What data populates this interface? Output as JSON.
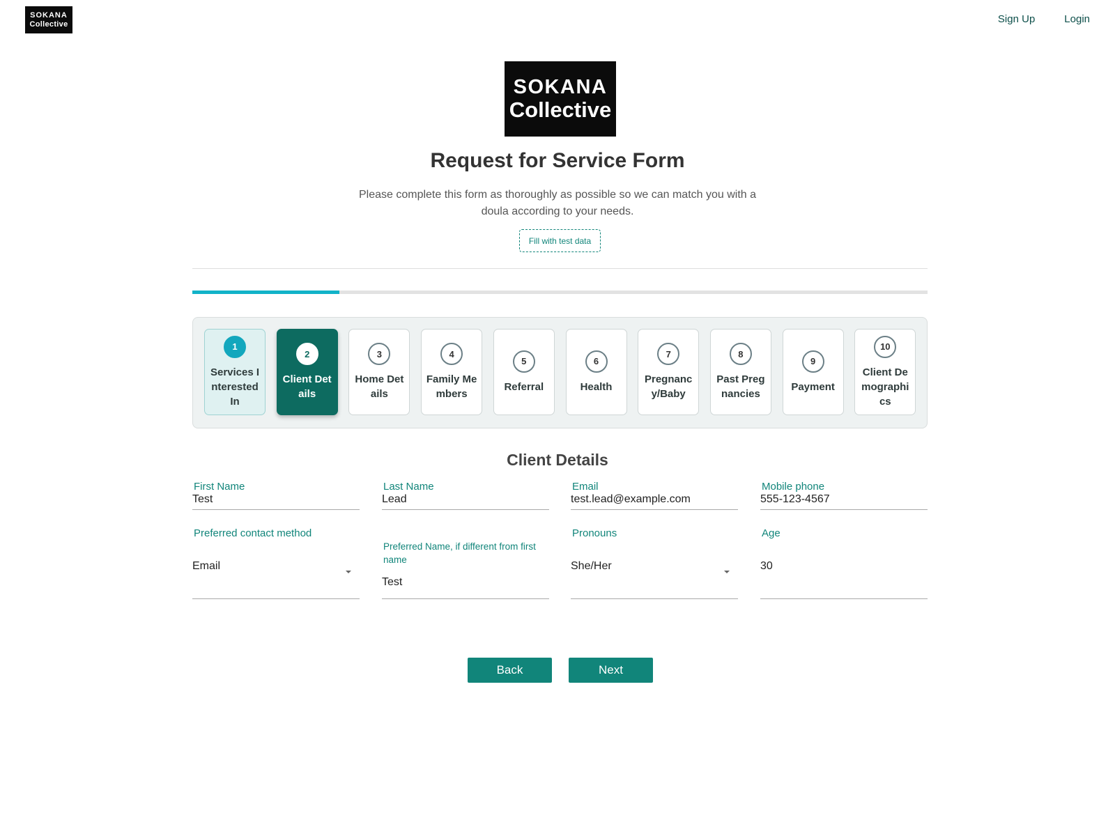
{
  "topbar": {
    "logo_line1": "SOKANA",
    "logo_line2": "Collective",
    "signup_label": "Sign Up",
    "login_label": "Login"
  },
  "header": {
    "logo_line1": "SOKANA",
    "logo_line2": "Collective",
    "title": "Request for Service Form",
    "subtitle": "Please complete this form as thoroughly as possible so we can match you with a doula according to your needs.",
    "test_data_label": "Fill with test data"
  },
  "progress": {
    "fraction": 0.2
  },
  "steps": [
    {
      "number": "1",
      "label": "Services Interested In",
      "state": "done"
    },
    {
      "number": "2",
      "label": "Client Details",
      "state": "active"
    },
    {
      "number": "3",
      "label": "Home Details",
      "state": "todo"
    },
    {
      "number": "4",
      "label": "Family Members",
      "state": "todo"
    },
    {
      "number": "5",
      "label": "Referral",
      "state": "todo"
    },
    {
      "number": "6",
      "label": "Health",
      "state": "todo"
    },
    {
      "number": "7",
      "label": "Pregnancy/Baby",
      "state": "todo"
    },
    {
      "number": "8",
      "label": "Past Pregnancies",
      "state": "todo"
    },
    {
      "number": "9",
      "label": "Payment",
      "state": "todo"
    },
    {
      "number": "10",
      "label": "Client Demographics",
      "state": "todo"
    }
  ],
  "form": {
    "section_title": "Client Details",
    "first_name": {
      "label": "First Name",
      "value": "Test"
    },
    "last_name": {
      "label": "Last Name",
      "value": "Lead"
    },
    "email": {
      "label": "Email",
      "value": "test.lead@example.com"
    },
    "mobile_phone": {
      "label": "Mobile phone",
      "value": "555-123-4567"
    },
    "contact_method": {
      "label": "Preferred contact method",
      "value": "Email"
    },
    "preferred_name": {
      "label": "Preferred Name, if different from first name",
      "value": "Test"
    },
    "pronouns": {
      "label": "Pronouns",
      "value": "She/Her"
    },
    "age": {
      "label": "Age",
      "value": "30"
    }
  },
  "buttons": {
    "back_label": "Back",
    "next_label": "Next"
  },
  "colors": {
    "brand_teal": "#11857a",
    "active_step": "#0d6b60",
    "progress_accent": "#12b3c8"
  }
}
